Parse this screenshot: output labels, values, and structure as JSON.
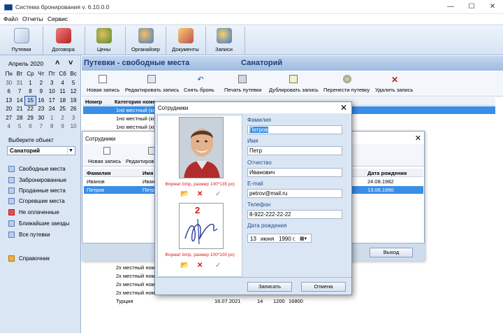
{
  "window": {
    "title": "Система бронирования v. 6.10.0.0",
    "min": "—",
    "max": "☐",
    "close": "✕"
  },
  "menu": [
    "Файл",
    "Отчеты",
    "Сервис"
  ],
  "toolbar": [
    "Путевки",
    "Договора",
    "Цены",
    "Органайзер",
    "Документы",
    "Записи"
  ],
  "calendar": {
    "month": "Апрель 2020",
    "prev": "˄",
    "next": "˅",
    "weekdays": [
      "Пн",
      "Вт",
      "Ср",
      "Чт",
      "Пт",
      "Сб",
      "Вс"
    ],
    "weeks": [
      [
        "30",
        "31",
        "1",
        "2",
        "3",
        "4",
        "5"
      ],
      [
        "6",
        "7",
        "8",
        "9",
        "10",
        "11",
        "12"
      ],
      [
        "13",
        "14",
        "15",
        "16",
        "17",
        "18",
        "19"
      ],
      [
        "20",
        "21",
        "22",
        "23",
        "24",
        "25",
        "26"
      ],
      [
        "27",
        "28",
        "29",
        "30",
        "1",
        "2",
        "3"
      ],
      [
        "4",
        "5",
        "6",
        "7",
        "8",
        "9",
        "10"
      ]
    ],
    "today": "15"
  },
  "left": {
    "select_label": "Выберите объект",
    "select_value": "Санаторий",
    "nav": [
      "Свободные места",
      "Забронированные",
      "Проданные места",
      "Сгоревшие места",
      "Не оплаченные",
      "Ближайшие заезды",
      "Все путевки"
    ],
    "reference": "Справочник"
  },
  "main": {
    "title": "Путевки - свободные места",
    "object": "Санаторий",
    "actions": [
      "Новая запись",
      "Редактировать запись",
      "Снять бронь",
      "Печать путевки",
      "Дублировать запись",
      "Перенести путевку",
      "Удалить запись"
    ],
    "columns": [
      "Номер",
      "Категория номе"
    ],
    "rows_top": [
      "1но местный (кор",
      "1но местный (кор",
      "1но местный (кор"
    ],
    "rows_bottom": [
      {
        "cat": "2х местный номе"
      },
      {
        "cat": "2х местный номе"
      },
      {
        "cat": "2х местный номе"
      },
      {
        "cat": "2х местный номе"
      },
      {
        "cat": "Турция",
        "date": "16.07.2021",
        "n1": "14",
        "n2": "1200",
        "n3": "16800"
      }
    ]
  },
  "staff_list": {
    "title": "Сотрудники",
    "actions": [
      "Новая запись",
      "Редактиров"
    ],
    "columns": [
      "Фамилия",
      "Имя",
      "Дата рождения"
    ],
    "rows": [
      {
        "last": "Иванов",
        "first": "Иван",
        "dob": "24.08.1982"
      },
      {
        "last": "Петров",
        "first": "Петр",
        "dob": "13.06.1990"
      }
    ],
    "exit": "Выход"
  },
  "staff_dialog": {
    "title": "Сотрудники",
    "photo_hint": "Формат bmp, размер 100*135 px)",
    "sign_hint": "Формат bmp, размер 100*100 px)",
    "sign_number": "2",
    "fields": {
      "last_label": "Фамилия",
      "last": "Петров",
      "first_label": "Имя",
      "first": "Петр",
      "middle_label": "Отчество",
      "middle": "Иванович",
      "email_label": "E-mail",
      "email": "petrov@mail.ru",
      "phone_label": "Телефон",
      "phone": "8-922-222-22-22",
      "dob_label": "Дата рождения",
      "dob_day": "13",
      "dob_month": "июня",
      "dob_year": "1990 г."
    },
    "save": "Записать",
    "cancel": "Отмена"
  }
}
